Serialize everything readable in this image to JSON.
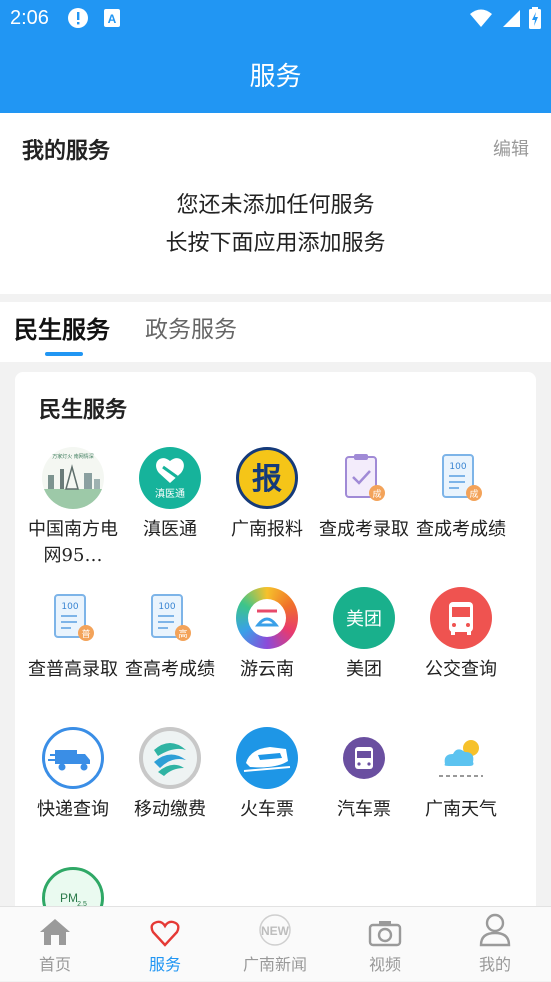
{
  "status_bar": {
    "time": "2:06"
  },
  "header": {
    "title": "服务"
  },
  "my_services": {
    "title": "我的服务",
    "edit_label": "编辑",
    "empty_line1": "您还未添加任何服务",
    "empty_line2": "长按下面应用添加服务"
  },
  "tabs": [
    {
      "label": "民生服务",
      "active": true
    },
    {
      "label": "政务服务",
      "active": false
    }
  ],
  "section": {
    "title": "民生服务",
    "items": [
      {
        "label": "中国南方电网95…",
        "icon": "power-grid-icon"
      },
      {
        "label": "滇医通",
        "icon": "dian-yi-tong-icon"
      },
      {
        "label": "广南报料",
        "icon": "bao-icon"
      },
      {
        "label": "查成考录取",
        "icon": "clipboard-check-icon"
      },
      {
        "label": "查成考成绩",
        "icon": "score-sheet-icon"
      },
      {
        "label": "查普高录取",
        "icon": "score-sheet-icon"
      },
      {
        "label": "查高考成绩",
        "icon": "score-sheet-icon"
      },
      {
        "label": "游云南",
        "icon": "you-yunnan-icon"
      },
      {
        "label": "美团",
        "icon": "meituan-icon"
      },
      {
        "label": "公交查询",
        "icon": "bus-icon"
      },
      {
        "label": "快递查询",
        "icon": "delivery-truck-icon"
      },
      {
        "label": "移动缴费",
        "icon": "china-mobile-icon"
      },
      {
        "label": "火车票",
        "icon": "train-icon"
      },
      {
        "label": "汽车票",
        "icon": "coach-bus-icon"
      },
      {
        "label": "广南天气",
        "icon": "weather-icon"
      },
      {
        "label": "",
        "icon": "pm25-icon"
      }
    ],
    "badges": {
      "xiancheng": "成",
      "putong": "普",
      "gaokao": "高",
      "score": "100",
      "pm": "PM",
      "pm_sub": "2.5",
      "meituan": "美团",
      "bao": "报",
      "dyt": "滇医通",
      "grid_banner": "万家灯火 南网情深"
    }
  },
  "bottom_nav": [
    {
      "label": "首页",
      "icon": "home-icon",
      "active": false
    },
    {
      "label": "服务",
      "icon": "heart-icon",
      "active": true
    },
    {
      "label": "广南新闻",
      "icon": "news-icon",
      "active": false,
      "icon_text": "NEW"
    },
    {
      "label": "视频",
      "icon": "camera-icon",
      "active": false
    },
    {
      "label": "我的",
      "icon": "user-icon",
      "active": false
    }
  ],
  "colors": {
    "primary": "#2196f3",
    "accent_red": "#e53935"
  }
}
